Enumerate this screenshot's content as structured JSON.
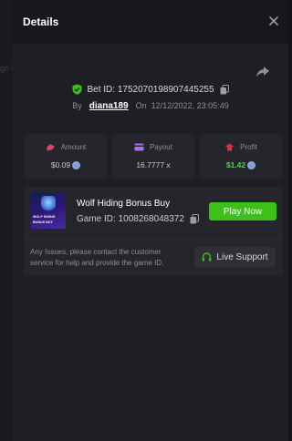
{
  "backdrop": {
    "ghost_text": "gh i"
  },
  "header": {
    "title": "Details",
    "close_icon": "close-icon"
  },
  "bet": {
    "id_label": "Bet ID:",
    "id_value": "1752070198907445255",
    "by_label": "By",
    "username": "diana189",
    "on_label": "On",
    "datetime": "12/12/2022, 23:05:49"
  },
  "stats": {
    "amount": {
      "label": "Amount",
      "value": "$0.09"
    },
    "payout": {
      "label": "Payout",
      "value": "16.7777 x"
    },
    "profit": {
      "label": "Profit",
      "value": "$1.42"
    }
  },
  "game": {
    "name": "Wolf Hiding Bonus Buy",
    "id_label": "Game ID:",
    "id_value": "1008268048372",
    "thumb_line1": "WOLF HIDING",
    "thumb_line2": "BONUS BUY",
    "play_label": "Play Now"
  },
  "support": {
    "issues_text": "Any Issues, please contact the customer service for help and provide the game ID.",
    "button_label": "Live Support"
  },
  "colors": {
    "accent_green": "#3bc117",
    "profit_green": "#4ad34a",
    "panel_bg": "#1e1f24",
    "card_bg": "#25262b"
  }
}
